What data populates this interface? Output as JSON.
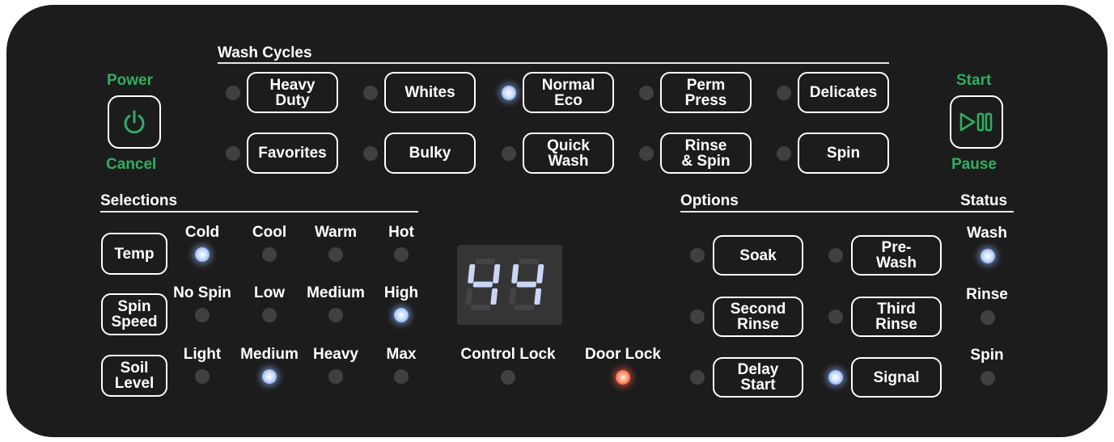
{
  "power": {
    "top_label": "Power",
    "bottom_label": "Cancel",
    "icon": "power-icon"
  },
  "start": {
    "top_label": "Start",
    "bottom_label": "Pause",
    "icon": "play-pause-icon"
  },
  "wash_cycles": {
    "title": "Wash Cycles",
    "row1": [
      {
        "label": "Heavy\nDuty",
        "led": "off"
      },
      {
        "label": "Whites",
        "led": "off"
      },
      {
        "label": "Normal\nEco",
        "led": "on"
      },
      {
        "label": "Perm\nPress",
        "led": "off"
      },
      {
        "label": "Delicates",
        "led": "off"
      }
    ],
    "row2": [
      {
        "label": "Favorites",
        "led": "off"
      },
      {
        "label": "Bulky",
        "led": "off"
      },
      {
        "label": "Quick\nWash",
        "led": "off"
      },
      {
        "label": "Rinse\n& Spin",
        "led": "off"
      },
      {
        "label": "Spin",
        "led": "off"
      }
    ]
  },
  "selections": {
    "title": "Selections",
    "rows": [
      {
        "button": "Temp",
        "levels": [
          "Cold",
          "Cool",
          "Warm",
          "Hot"
        ],
        "active": 0
      },
      {
        "button": "Spin\nSpeed",
        "levels": [
          "No Spin",
          "Low",
          "Medium",
          "High"
        ],
        "active": 3
      },
      {
        "button": "Soil\nLevel",
        "levels": [
          "Light",
          "Medium",
          "Heavy",
          "Max"
        ],
        "active": 1
      }
    ]
  },
  "display": {
    "value": "44",
    "color": "#c9d6f5"
  },
  "locks": {
    "control_lock": {
      "label": "Control Lock",
      "led": "off"
    },
    "door_lock": {
      "label": "Door Lock",
      "led": "red"
    }
  },
  "options": {
    "title": "Options",
    "rows": [
      [
        {
          "label": "Soak",
          "led": "off"
        },
        {
          "label": "Pre-\nWash",
          "led": "off"
        }
      ],
      [
        {
          "label": "Second\nRinse",
          "led": "off"
        },
        {
          "label": "Third\nRinse",
          "led": "off"
        }
      ],
      [
        {
          "label": "Delay\nStart",
          "led": "off"
        },
        {
          "label": "Signal",
          "led": "on"
        }
      ]
    ]
  },
  "status": {
    "title": "Status",
    "items": [
      {
        "label": "Wash",
        "led": "on"
      },
      {
        "label": "Rinse",
        "led": "off"
      },
      {
        "label": "Spin",
        "led": "off"
      }
    ]
  },
  "colors": {
    "panel": "#1d1c1d",
    "accent_green": "#2fae5f",
    "led_blue": "#8fb3f2",
    "led_red": "#f04b2e",
    "led_off": "#414041"
  }
}
